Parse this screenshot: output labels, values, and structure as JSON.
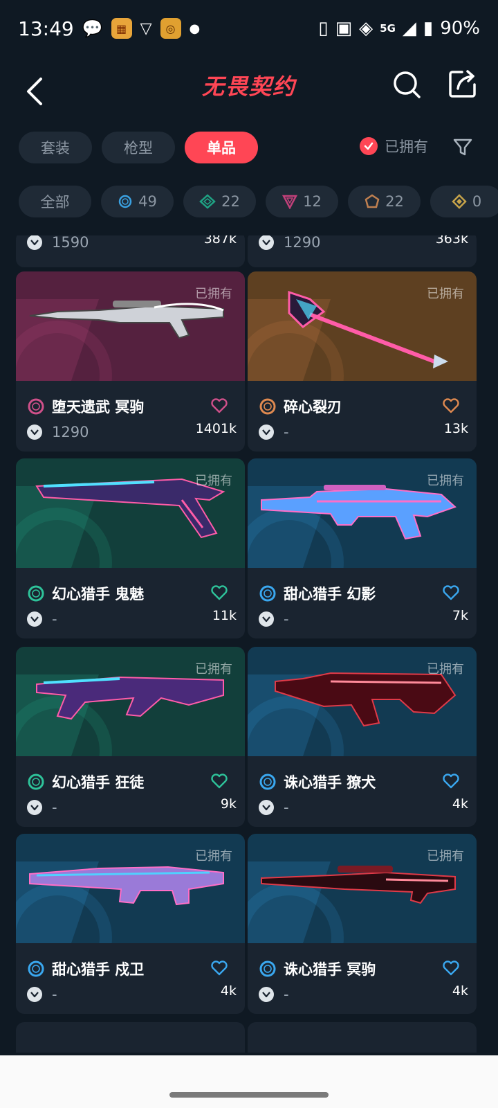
{
  "status_bar": {
    "time": "13:49",
    "battery": "90%",
    "network": "5G"
  },
  "header": {
    "title": "无畏契约"
  },
  "tabs": [
    {
      "label": "套装"
    },
    {
      "label": "枪型"
    },
    {
      "label": "单品"
    }
  ],
  "owned_filter": {
    "label": "已拥有"
  },
  "tiers": [
    {
      "label": "全部",
      "icon": "",
      "color": "#8c97a3"
    },
    {
      "label": "49",
      "icon": "tier-select-icon",
      "color": "#3aa0e0"
    },
    {
      "label": "22",
      "icon": "tier-deluxe-icon",
      "color": "#1fa384"
    },
    {
      "label": "12",
      "icon": "tier-premium-icon",
      "color": "#c2407a"
    },
    {
      "label": "22",
      "icon": "tier-exclusive-icon",
      "color": "#c08050"
    },
    {
      "label": "0",
      "icon": "tier-ultra-icon",
      "color": "#c6a34a"
    }
  ],
  "partial_row": [
    {
      "price": "1590",
      "likes": "387k"
    },
    {
      "price": "1290",
      "likes": "363k"
    }
  ],
  "owned_label": "已拥有",
  "skins": [
    {
      "name": "堕天遗武 冥驹",
      "price": "1290",
      "likes": "1401k",
      "tier_color": "#d0508a",
      "heart_color": "#d0508a",
      "bg": "#55213f",
      "weapon": "sniper"
    },
    {
      "name": "碎心裂刃",
      "price": "-",
      "likes": "13k",
      "tier_color": "#e08a50",
      "heart_color": "#e08a50",
      "bg": "#5e4021",
      "weapon": "melee"
    },
    {
      "name": "幻心猎手 鬼魅",
      "price": "-",
      "likes": "11k",
      "tier_color": "#2ec39a",
      "heart_color": "#2ec39a",
      "bg": "#123f3b",
      "weapon": "pistol"
    },
    {
      "name": "甜心猎手 幻影",
      "price": "-",
      "likes": "7k",
      "tier_color": "#3aa8f0",
      "heart_color": "#3aa8f0",
      "bg": "#123a52",
      "weapon": "rifle"
    },
    {
      "name": "幻心猎手 狂徒",
      "price": "-",
      "likes": "9k",
      "tier_color": "#2ec39a",
      "heart_color": "#2ec39a",
      "bg": "#123f3b",
      "weapon": "rifle2"
    },
    {
      "name": "诛心猎手 獠犬",
      "price": "-",
      "likes": "4k",
      "tier_color": "#3aa8f0",
      "heart_color": "#3aa8f0",
      "bg": "#123a52",
      "weapon": "smg"
    },
    {
      "name": "甜心猎手 戍卫",
      "price": "-",
      "likes": "4k",
      "tier_color": "#3aa8f0",
      "heart_color": "#3aa8f0",
      "bg": "#123a52",
      "weapon": "guardian"
    },
    {
      "name": "诛心猎手 冥驹",
      "price": "-",
      "likes": "4k",
      "tier_color": "#3aa8f0",
      "heart_color": "#3aa8f0",
      "bg": "#123a52",
      "weapon": "sniper2"
    }
  ]
}
